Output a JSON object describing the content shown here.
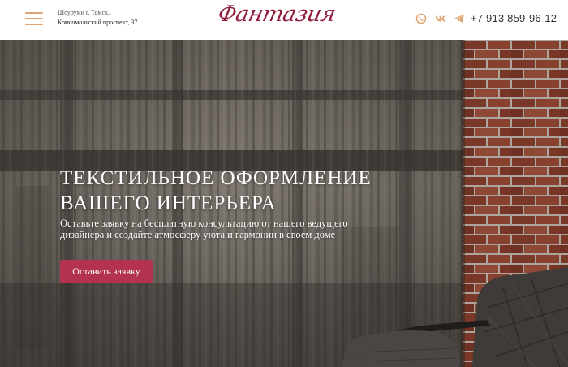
{
  "header": {
    "address_line1": "Шоуруми г. Томск.,",
    "address_line2": "Комсомольский проспект, 37",
    "logo_text": "Фантазия",
    "phone": "+7 913 859-96-12",
    "icons": {
      "menu": "burger-menu-icon",
      "whatsapp": "whatsapp-icon",
      "vk": "vk-icon",
      "telegram": "telegram-icon"
    }
  },
  "hero": {
    "title_line1": "Текстильное оформление",
    "title_line2": "вашего интерьера",
    "subtitle": "Оставьте заявку на бесплатную консультацию от нашего ведущего дизайнера и создайте атмосферу уюта и гармонии в своем доме",
    "cta_label": "Оставить заявку"
  },
  "colors": {
    "accent": "#e0a472",
    "brand": "#8f1d3b",
    "button": "#b2324f",
    "icon": "#e0a472"
  }
}
